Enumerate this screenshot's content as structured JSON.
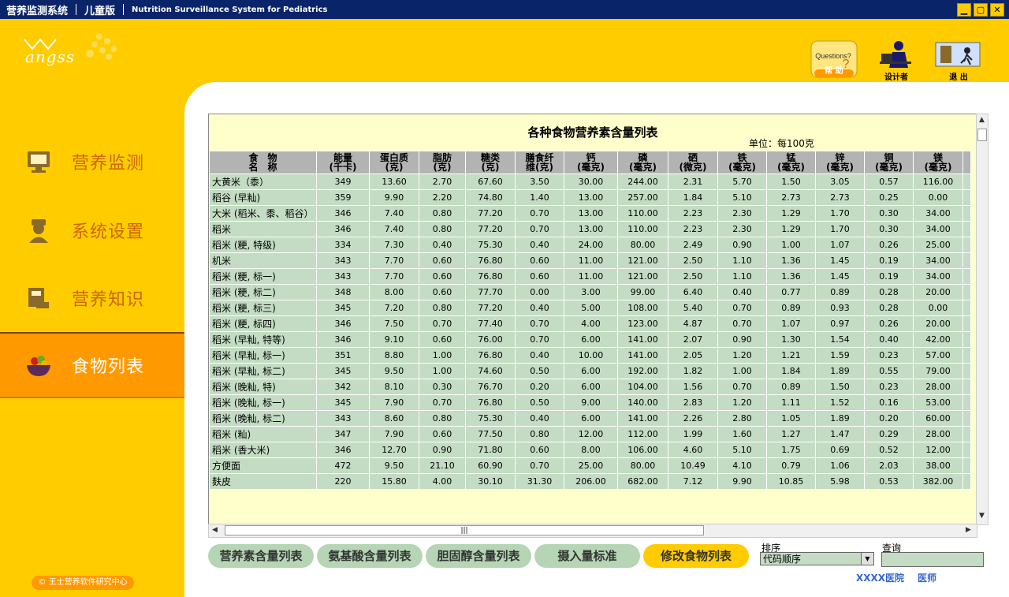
{
  "titlebar": {
    "app_name": "营养监测系统",
    "edition": "儿童版",
    "english": "Nutrition Surveillance System for Pediatrics",
    "minimize": "▁",
    "maximize": "▢",
    "close": "✕"
  },
  "logo": {
    "text": "angss"
  },
  "toolbar": {
    "help_label": "帮 助",
    "designer_label": "设计者",
    "exit_label": "退 出"
  },
  "sidebar": {
    "items": [
      {
        "label": "营养监测"
      },
      {
        "label": "系统设置"
      },
      {
        "label": "营养知识"
      },
      {
        "label": "食物列表",
        "active": true
      }
    ],
    "copyright": "© 王士营养软件研究中心"
  },
  "table": {
    "title": "各种食物营养素含量列表",
    "unit": "单位：每100克",
    "headers": [
      [
        "食　物",
        "名　称"
      ],
      [
        "能量",
        "(千卡)"
      ],
      [
        "蛋白质",
        "(克)"
      ],
      [
        "脂肪",
        "(克)"
      ],
      [
        "糖类",
        "(克)"
      ],
      [
        "膳食纤",
        "维(克)"
      ],
      [
        "钙",
        "(毫克)"
      ],
      [
        "磷",
        "(毫克)"
      ],
      [
        "硒",
        "(微克)"
      ],
      [
        "铁",
        "(毫克)"
      ],
      [
        "锰",
        "(毫克)"
      ],
      [
        "锌",
        "(毫克)"
      ],
      [
        "铜",
        "(毫克)"
      ],
      [
        "镁",
        "(毫克)"
      ]
    ],
    "rows": [
      [
        "大黄米（黍）",
        "349",
        "13.60",
        "2.70",
        "67.60",
        "3.50",
        "30.00",
        "244.00",
        "2.31",
        "5.70",
        "1.50",
        "3.05",
        "0.57",
        "116.00"
      ],
      [
        "稻谷 (早籼)",
        "359",
        "9.90",
        "2.20",
        "74.80",
        "1.40",
        "13.00",
        "257.00",
        "1.84",
        "5.10",
        "2.73",
        "2.73",
        "0.25",
        "0.00"
      ],
      [
        "大米 (稻米、黍、稻谷）",
        "346",
        "7.40",
        "0.80",
        "77.20",
        "0.70",
        "13.00",
        "110.00",
        "2.23",
        "2.30",
        "1.29",
        "1.70",
        "0.30",
        "34.00"
      ],
      [
        "稻米",
        "346",
        "7.40",
        "0.80",
        "77.20",
        "0.70",
        "13.00",
        "110.00",
        "2.23",
        "2.30",
        "1.29",
        "1.70",
        "0.30",
        "34.00"
      ],
      [
        "稻米 (粳, 特级)",
        "334",
        "7.30",
        "0.40",
        "75.30",
        "0.40",
        "24.00",
        "80.00",
        "2.49",
        "0.90",
        "1.00",
        "1.07",
        "0.26",
        "25.00"
      ],
      [
        "机米",
        "343",
        "7.70",
        "0.60",
        "76.80",
        "0.60",
        "11.00",
        "121.00",
        "2.50",
        "1.10",
        "1.36",
        "1.45",
        "0.19",
        "34.00"
      ],
      [
        "稻米 (粳, 标一)",
        "343",
        "7.70",
        "0.60",
        "76.80",
        "0.60",
        "11.00",
        "121.00",
        "2.50",
        "1.10",
        "1.36",
        "1.45",
        "0.19",
        "34.00"
      ],
      [
        "稻米 (粳, 标二)",
        "348",
        "8.00",
        "0.60",
        "77.70",
        "0.00",
        "3.00",
        "99.00",
        "6.40",
        "0.40",
        "0.77",
        "0.89",
        "0.28",
        "20.00"
      ],
      [
        "稻米 (粳, 标三)",
        "345",
        "7.20",
        "0.80",
        "77.20",
        "0.40",
        "5.00",
        "108.00",
        "5.40",
        "0.70",
        "0.89",
        "0.93",
        "0.28",
        "0.00"
      ],
      [
        "稻米 (粳, 标四)",
        "346",
        "7.50",
        "0.70",
        "77.40",
        "0.70",
        "4.00",
        "123.00",
        "4.87",
        "0.70",
        "1.07",
        "0.97",
        "0.26",
        "20.00"
      ],
      [
        "稻米 (早籼, 特等)",
        "346",
        "9.10",
        "0.60",
        "76.00",
        "0.70",
        "6.00",
        "141.00",
        "2.07",
        "0.90",
        "1.30",
        "1.54",
        "0.40",
        "42.00"
      ],
      [
        "稻米 (早籼, 标一)",
        "351",
        "8.80",
        "1.00",
        "76.80",
        "0.40",
        "10.00",
        "141.00",
        "2.05",
        "1.20",
        "1.21",
        "1.59",
        "0.23",
        "57.00"
      ],
      [
        "稻米 (早籼, 标二)",
        "345",
        "9.50",
        "1.00",
        "74.60",
        "0.50",
        "6.00",
        "192.00",
        "1.82",
        "1.00",
        "1.84",
        "1.89",
        "0.55",
        "79.00"
      ],
      [
        "稻米 (晚籼, 特)",
        "342",
        "8.10",
        "0.30",
        "76.70",
        "0.20",
        "6.00",
        "104.00",
        "1.56",
        "0.70",
        "0.89",
        "1.50",
        "0.23",
        "28.00"
      ],
      [
        "稻米 (晚籼, 标一)",
        "345",
        "7.90",
        "0.70",
        "76.80",
        "0.50",
        "9.00",
        "140.00",
        "2.83",
        "1.20",
        "1.11",
        "1.52",
        "0.16",
        "53.00"
      ],
      [
        "稻米 (晚籼, 标二)",
        "343",
        "8.60",
        "0.80",
        "75.30",
        "0.40",
        "6.00",
        "141.00",
        "2.26",
        "2.80",
        "1.05",
        "1.89",
        "0.20",
        "60.00"
      ],
      [
        "稻米 (籼)",
        "347",
        "7.90",
        "0.60",
        "77.50",
        "0.80",
        "12.00",
        "112.00",
        "1.99",
        "1.60",
        "1.27",
        "1.47",
        "0.29",
        "28.00"
      ],
      [
        "稻米 (香大米)",
        "346",
        "12.70",
        "0.90",
        "71.80",
        "0.60",
        "8.00",
        "106.00",
        "4.60",
        "5.10",
        "1.75",
        "0.69",
        "0.52",
        "12.00"
      ],
      [
        "方便面",
        "472",
        "9.50",
        "21.10",
        "60.90",
        "0.70",
        "25.00",
        "80.00",
        "10.49",
        "4.10",
        "0.79",
        "1.06",
        "2.03",
        "38.00"
      ],
      [
        "麸皮",
        "220",
        "15.80",
        "4.00",
        "30.10",
        "31.30",
        "206.00",
        "682.00",
        "7.12",
        "9.90",
        "10.85",
        "5.98",
        "0.53",
        "382.00"
      ]
    ],
    "hscroll_grip": "|||"
  },
  "buttons": [
    {
      "label": "营养素含量列表"
    },
    {
      "label": "氨基酸含量列表"
    },
    {
      "label": "胆固醇含量列表"
    },
    {
      "label": "摄入量标准"
    },
    {
      "label": "修改食物列表",
      "selected": true
    }
  ],
  "sort": {
    "label": "排序",
    "value": "代码顺序"
  },
  "query": {
    "label": "查询",
    "value": ""
  },
  "footer": {
    "hospital": "XXXX医院",
    "doctor": "医师"
  },
  "colors": {
    "accent": "#ffcc00",
    "active_nav": "#ff9900",
    "table_cell": "#c3dcc3",
    "header_cell": "#b3b3b3"
  }
}
